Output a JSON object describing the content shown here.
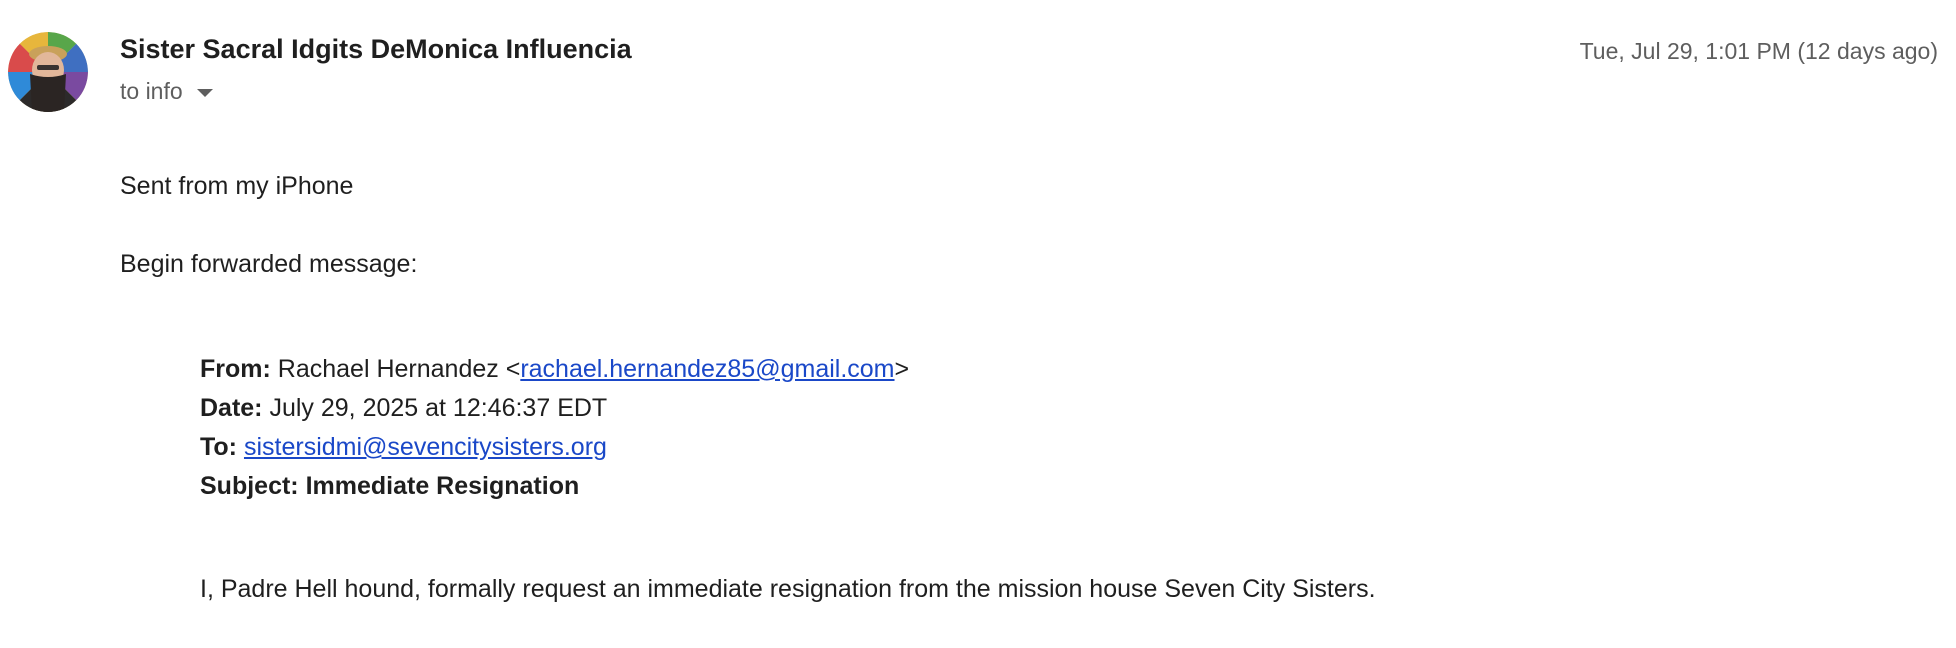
{
  "email": {
    "sender_name": "Sister Sacral Idgits DeMonica Influencia",
    "recipient_line": "to info",
    "timestamp": "Tue, Jul 29, 1:01 PM (12 days ago)",
    "body_lines": [
      "Sent from my iPhone",
      "Begin forwarded message:"
    ],
    "forwarded": {
      "from_label": "From:",
      "from_name": "Rachael Hernandez <",
      "from_email": "rachael.hernandez85@gmail.com",
      "from_close": ">",
      "date_label": "Date:",
      "date_value": "July 29, 2025 at 12:46:37 EDT",
      "to_label": "To:",
      "to_email": "sistersidmi@sevencitysisters.org",
      "subject_label": "Subject:",
      "subject_value": "Immediate Resignation",
      "message": "I, Padre Hell hound, formally request an immediate resignation from the mission house Seven City Sisters."
    }
  },
  "icons": {
    "avatar": "sender-avatar",
    "recipient_toggle": "chevron-down-icon"
  },
  "colors": {
    "link": "#1a48c8",
    "secondary_text": "#5e5e5e",
    "primary_text": "#1f1f1f"
  }
}
